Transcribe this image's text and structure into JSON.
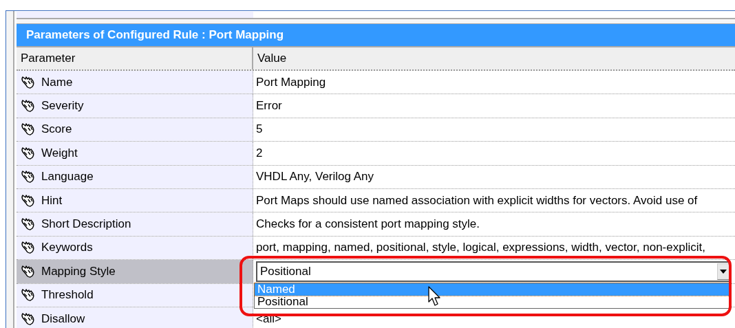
{
  "panel": {
    "title": "Parameters of Configured Rule : Port Mapping",
    "columns": [
      "Parameter",
      "Value"
    ],
    "rows": [
      {
        "kind": "text",
        "parameter": "Name",
        "value": "Port Mapping",
        "selected": false
      },
      {
        "kind": "text",
        "parameter": "Severity",
        "value": "Error",
        "selected": false
      },
      {
        "kind": "text",
        "parameter": "Score",
        "value": "5",
        "selected": false
      },
      {
        "kind": "text",
        "parameter": "Weight",
        "value": "2",
        "selected": false
      },
      {
        "kind": "text",
        "parameter": "Language",
        "value": "VHDL Any, Verilog Any",
        "selected": false
      },
      {
        "kind": "text",
        "parameter": "Hint",
        "value": "Port Maps should use named association with explicit widths for vectors. Avoid use of",
        "selected": false
      },
      {
        "kind": "text",
        "parameter": "Short Description",
        "value": "Checks for a consistent port mapping style.",
        "selected": false
      },
      {
        "kind": "text",
        "parameter": "Keywords",
        "value": "port, mapping, named, positional, style, logical, expressions, width, vector, non-explicit,",
        "selected": false
      },
      {
        "kind": "dropdown",
        "parameter": "Mapping Style",
        "value": "Positional",
        "selected": true,
        "expanded": true,
        "options": [
          {
            "label": "Named",
            "highlighted": true
          },
          {
            "label": "Positional",
            "highlighted": false
          }
        ]
      },
      {
        "kind": "text",
        "parameter": "Threshold",
        "selected": false
      },
      {
        "kind": "text",
        "parameter": "Disallow",
        "value": "<all>",
        "selected": false
      }
    ]
  }
}
